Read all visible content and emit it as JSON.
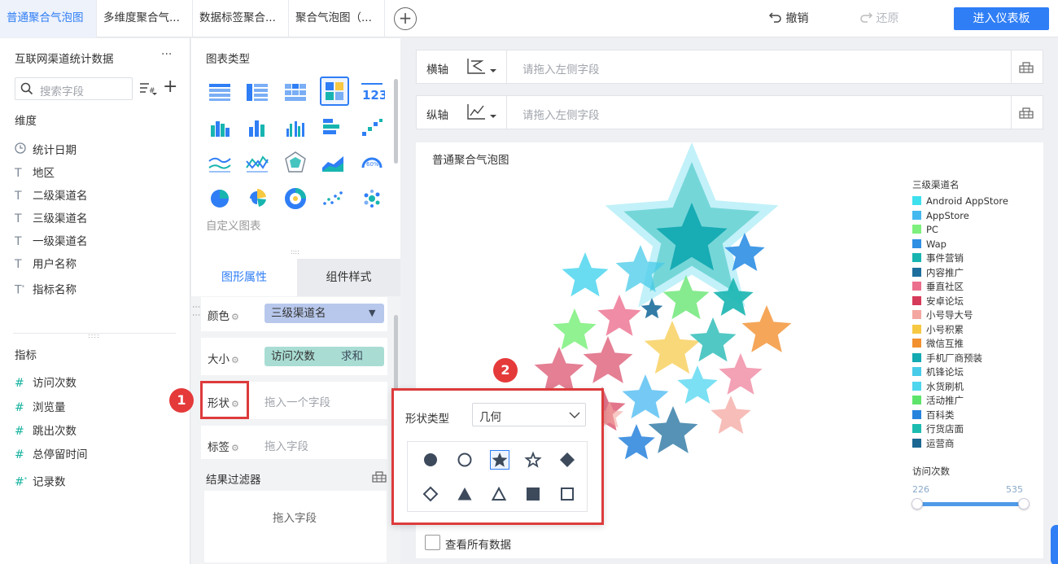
{
  "tabs": [
    "普通聚合气泡图",
    "多维度聚合气...",
    "数据标签聚合...",
    "聚合气泡图（..."
  ],
  "toolbar": {
    "undo": "撤销",
    "redo": "还原",
    "dashboard": "进入仪表板"
  },
  "left": {
    "dataset": "互联网渠道统计数据",
    "more": "···",
    "search_placeholder": "搜索字段",
    "dimension_title": "维度",
    "dimensions": [
      "统计日期",
      "地区",
      "二级渠道名",
      "三级渠道名",
      "一级渠道名",
      "用户名称",
      "指标名称"
    ],
    "measure_title": "指标",
    "measures": [
      "访问次数",
      "浏览量",
      "跳出次数",
      "总停留时间",
      "记录数"
    ]
  },
  "middle": {
    "chart_type_title": "图表类型",
    "custom_chart": "自定义图表",
    "prop_tabs": [
      "图形属性",
      "组件样式"
    ],
    "color_label": "颜色",
    "color_field": "三级渠道名",
    "size_label": "大小",
    "size_field": "访问次数",
    "size_agg": "求和",
    "shape_label": "形状",
    "shape_placeholder": "拖入一个字段",
    "tag_label": "标签",
    "tag_placeholder": "拖入字段",
    "filter_title": "结果过滤器",
    "filter_placeholder": "拖入字段"
  },
  "axes": {
    "x_label": "横轴",
    "x_placeholder": "请拖入左侧字段",
    "y_label": "纵轴",
    "y_placeholder": "请拖入左侧字段"
  },
  "chart": {
    "title": "普通聚合气泡图",
    "legend_title": "三级渠道名",
    "legend": [
      {
        "name": "Android AppStore",
        "color": "#3fe0ee"
      },
      {
        "name": "AppStore",
        "color": "#45b8f0"
      },
      {
        "name": "PC",
        "color": "#7df07d"
      },
      {
        "name": "Wap",
        "color": "#2f8fe3"
      },
      {
        "name": "事件营销",
        "color": "#18b5b0"
      },
      {
        "name": "内容推广",
        "color": "#1d6e9c"
      },
      {
        "name": "垂直社区",
        "color": "#ec6f8e"
      },
      {
        "name": "安卓论坛",
        "color": "#d63a5a"
      },
      {
        "name": "小号导大号",
        "color": "#f4a7a0"
      },
      {
        "name": "小号积累",
        "color": "#f7c842"
      },
      {
        "name": "微信互推",
        "color": "#f2902f"
      },
      {
        "name": "手机厂商预装",
        "color": "#13aab2"
      },
      {
        "name": "机锋论坛",
        "color": "#47cbe8"
      },
      {
        "name": "水货刷机",
        "color": "#4fd6ef"
      },
      {
        "name": "活动推广",
        "color": "#5ee46a"
      },
      {
        "name": "百科类",
        "color": "#2883dd"
      },
      {
        "name": "行货店面",
        "color": "#1cbcb0"
      },
      {
        "name": "运营商",
        "color": "#1c6792"
      }
    ],
    "size_title": "访问次数",
    "size_min": "226",
    "size_max": "535",
    "show_all": "查看所有数据"
  },
  "popup": {
    "shape_type_label": "形状类型",
    "shape_type_value": "几何",
    "shapes": [
      "circle",
      "circle-outline",
      "star-filled-selected",
      "star-outline",
      "diamond",
      "diamond-outline",
      "triangle",
      "triangle-outline",
      "square",
      "square-outline"
    ]
  },
  "markers": {
    "one": "1",
    "two": "2"
  }
}
